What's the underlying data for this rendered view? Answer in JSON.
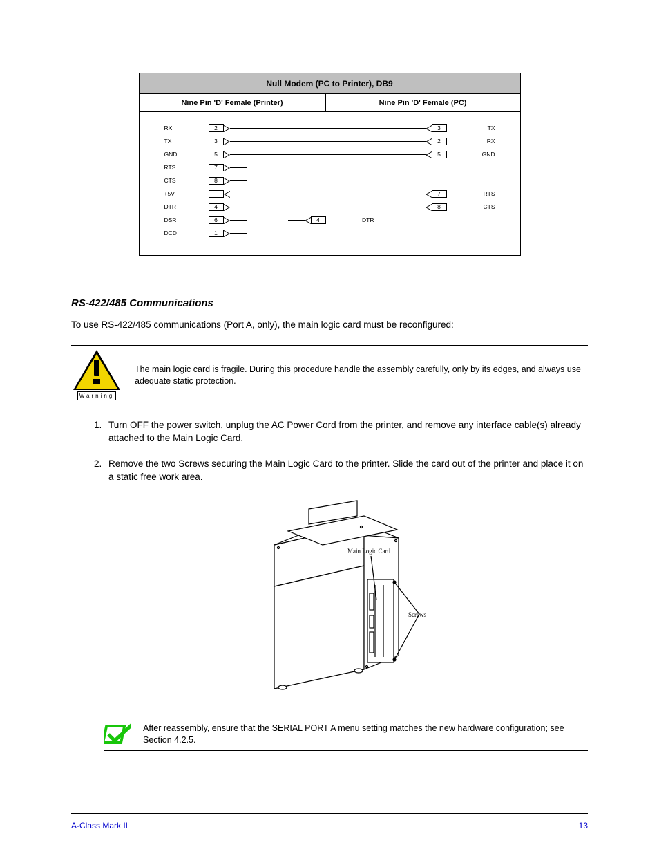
{
  "table": {
    "heading": "Null Modem (PC to Printer), DB9",
    "col_left": "Nine Pin 'D' Female (Printer)",
    "col_right": "Nine Pin 'D' Female (PC)",
    "left_device": "Printer",
    "right_device": "PC",
    "rows": [
      {
        "l_pin": "2",
        "l_sig": "RX",
        "r_pin": "3",
        "r_sig": "TX",
        "wire": "full",
        "l_arrow": "r",
        "r_arrow": "l"
      },
      {
        "l_pin": "3",
        "l_sig": "TX",
        "r_pin": "2",
        "r_sig": "RX",
        "wire": "full",
        "l_arrow": "r",
        "r_arrow": "l"
      },
      {
        "l_pin": "5",
        "l_sig": "GND",
        "r_pin": "5",
        "r_sig": "GND",
        "wire": "full",
        "l_arrow": "r",
        "r_arrow": "l"
      },
      {
        "l_pin": "7",
        "l_sig": "RTS",
        "r_pin": "",
        "r_sig": "",
        "wire": "stub",
        "l_arrow": "r",
        "r_arrow": ""
      },
      {
        "l_pin": "8",
        "l_sig": "CTS",
        "r_pin": "",
        "r_sig": "",
        "wire": "stub",
        "l_arrow": "r",
        "r_arrow": ""
      },
      {
        "l_pin": "",
        "l_sig": "+5V",
        "r_pin": "7",
        "r_sig": "RTS",
        "wire": "full",
        "l_arrow": "l",
        "r_arrow": "l"
      },
      {
        "l_pin": "4",
        "l_sig": "DTR",
        "r_pin": "8",
        "r_sig": "CTS",
        "wire": "full",
        "l_arrow": "r",
        "r_arrow": "l"
      },
      {
        "l_pin": "6",
        "l_sig": "DSR",
        "r_pin": "4",
        "r_sig": "DTR",
        "wire": "half",
        "l_arrow": "r",
        "r_arrow": "l"
      },
      {
        "l_pin": "1",
        "l_sig": "DCD",
        "r_pin": "",
        "r_sig": "",
        "wire": "stub",
        "l_arrow": "r",
        "r_arrow": ""
      }
    ]
  },
  "section_title": "RS-422/485 Communications",
  "intro_text": "To use RS-422/485 communications (Port A, only), the main logic card must be reconfigured:",
  "warning": {
    "label": "Warning",
    "text": "The main logic card is fragile. During this procedure handle the assembly carefully, only by its edges, and always use adequate static protection."
  },
  "steps": [
    "Turn OFF the power switch, unplug the AC Power Cord from the printer, and remove any interface cable(s) already attached to the Main Logic Card.",
    "Remove the two Screws securing the Main Logic Card to the printer. Slide the card out of the printer and place it on a static free work area."
  ],
  "figure_caption_top": "Main Logic Card",
  "figure_caption_bottom": "Screws",
  "note_text": "After reassembly, ensure that the SERIAL PORT A menu setting matches the new hardware configuration; see Section 4.2.5.",
  "footer_left": "A-Class Mark II",
  "footer_right": "13"
}
